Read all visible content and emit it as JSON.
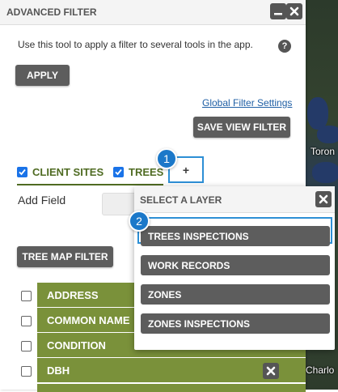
{
  "map": {
    "labels": [
      "Toron",
      "Charlo"
    ]
  },
  "panel": {
    "title": "ADVANCED FILTER",
    "minimize_icon": "minimize-icon",
    "close_icon": "close-icon",
    "description": "Use this tool to apply a filter to several tools in the app.",
    "help_icon": "?",
    "apply_label": "APPLY",
    "global_filter_link": "Global Filter Settings",
    "save_view_filter_label": "SAVE VIEW FILTER",
    "tabs": [
      {
        "label": "CLIENT SITES",
        "checked": true
      },
      {
        "label": "TREES",
        "checked": true
      }
    ],
    "add_tab_label": "+",
    "add_field_label": "Add Field",
    "tree_map_filter_label": "TREE MAP FILTER",
    "fields": [
      "ADDRESS",
      "COMMON NAME",
      "CONDITION",
      "DBH"
    ]
  },
  "callouts": [
    "1",
    "2"
  ],
  "popup": {
    "title": "SELECT A LAYER",
    "layers": [
      "TREES INSPECTIONS",
      "WORK RECORDS",
      "ZONES",
      "ZONES INSPECTIONS"
    ]
  },
  "colors": {
    "field_green": "#7a913a",
    "tab_green": "#4f6b22",
    "button_gray": "#5d5d5d",
    "focus_blue": "#2d8fd5",
    "badge_blue": "#1b78c9",
    "checkbox_blue": "#1a73e8"
  }
}
